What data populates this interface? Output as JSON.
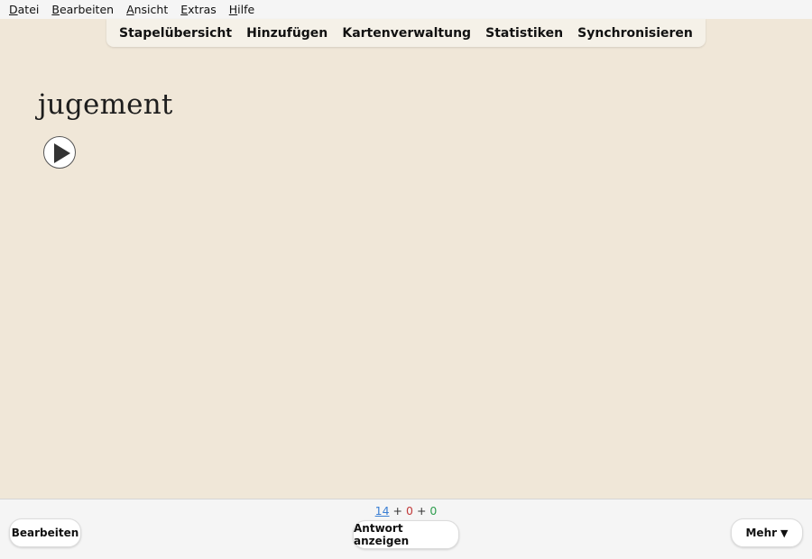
{
  "menubar": {
    "items": [
      {
        "label": "Datei",
        "accel": "D",
        "rest": "atei"
      },
      {
        "label": "Bearbeiten",
        "accel": "B",
        "rest": "earbeiten"
      },
      {
        "label": "Ansicht",
        "accel": "A",
        "rest": "nsicht"
      },
      {
        "label": "Extras",
        "accel": "E",
        "rest": "xtras"
      },
      {
        "label": "Hilfe",
        "accel": "H",
        "rest": "ilfe"
      }
    ]
  },
  "toolbar": {
    "decks": "Stapelübersicht",
    "add": "Hinzufügen",
    "browse": "Kartenverwaltung",
    "stats": "Statistiken",
    "sync": "Synchronisieren"
  },
  "card": {
    "front": "jugement",
    "audio_icon": "play-icon"
  },
  "bottombar": {
    "counts": {
      "new": "14",
      "learning": "0",
      "review": "0",
      "separator": "+"
    },
    "edit_label": "Bearbeiten",
    "show_answer_label": "Antwort anzeigen",
    "more_label": "Mehr",
    "more_caret": "▼"
  },
  "colors": {
    "background": "#f0e7d8",
    "new_count": "#3b7fd4",
    "learning_count": "#c23b3b",
    "review_count": "#2f9e4f"
  }
}
